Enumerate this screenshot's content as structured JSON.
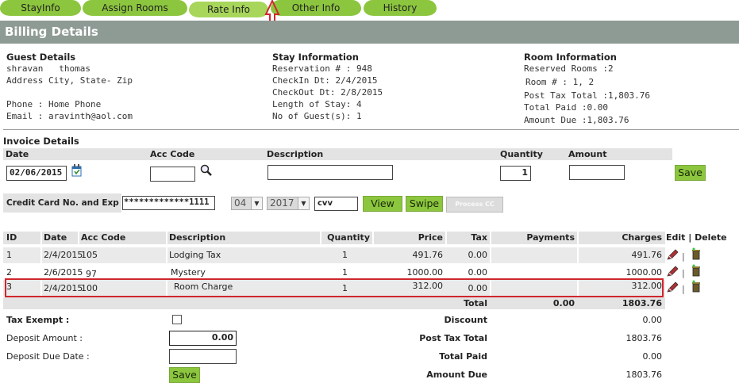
{
  "tabs": [
    {
      "label": "StayInfo"
    },
    {
      "label": "Assign Rooms"
    },
    {
      "label": "Rate Info"
    },
    {
      "label": "Other Info"
    },
    {
      "label": "History"
    }
  ],
  "billing_title": "Billing Details",
  "guest": {
    "title": "Guest Details",
    "name": "shravan   thomas",
    "address": "Address City, State- Zip",
    "phone": "Phone : Home Phone",
    "email": "Email : aravinth@aol.com"
  },
  "stay": {
    "title": "Stay Information",
    "reservation": "Reservation # : 948",
    "checkin": "CheckIn Dt: 2/4/2015",
    "checkout": "CheckOut Dt: 2/8/2015",
    "length": "Length of Stay: 4",
    "guests": "No of Guest(s): 1"
  },
  "room": {
    "title": "Room Information",
    "reserved": "Reserved Rooms :2",
    "room_no": "Room # : 1, 2",
    "post_tax_total": "Post Tax Total :1,803.76",
    "total_paid": "Total Paid :0.00",
    "amount_due": "Amount Due :1,803.76"
  },
  "invoice": {
    "title": "Invoice Details",
    "headers": {
      "date": "Date",
      "acc_code": "Acc Code",
      "description": "Description",
      "quantity": "Quantity",
      "amount": "Amount"
    },
    "date_value": "02/06/2015",
    "acc_code_value": "",
    "description_value": "",
    "quantity_value": "1",
    "amount_value": "",
    "save_label": "Save"
  },
  "credit_card": {
    "label": "Credit Card No. and Exp Dt",
    "number": "*************1111",
    "month": "04",
    "year": "2017",
    "cvv": "cvv",
    "view_label": "View",
    "swipe_label": "Swipe",
    "process_label": "Process CC"
  },
  "table": {
    "headers": {
      "id": "ID",
      "date": "Date",
      "acc_code": "Acc Code",
      "description": "Description",
      "quantity": "Quantity",
      "price": "Price",
      "tax": "Tax",
      "payments": "Payments",
      "charges": "Charges",
      "edit_delete": "Edit | Delete"
    },
    "rows": [
      {
        "id": "1",
        "date": "2/4/2015",
        "acc_code": "105",
        "description": "Lodging Tax",
        "quantity": "1",
        "price": "491.76",
        "tax": "0.00",
        "payments": "",
        "charges": "491.76"
      },
      {
        "id": "2",
        "date": "2/6/2015",
        "acc_code": "97",
        "description": "Mystery",
        "quantity": "1",
        "price": "1000.00",
        "tax": "0.00",
        "payments": "",
        "charges": "1000.00"
      },
      {
        "id": "3",
        "date": "2/4/2015",
        "acc_code": "100",
        "description": "Room Charge",
        "quantity": "1",
        "price": "312.00",
        "tax": "0.00",
        "payments": "",
        "charges": "312.00"
      }
    ],
    "total_label": "Total",
    "total_payments": "0.00",
    "total_charges": "1803.76",
    "edit_sep": "|"
  },
  "summary": {
    "tax_exempt_label": "Tax Exempt :",
    "deposit_amount_label": "Deposit Amount :",
    "deposit_amount_value": "0.00",
    "deposit_due_label": "Deposit Due Date :",
    "deposit_due_value": "",
    "save_label": "Save",
    "discount_label": "Discount",
    "discount_value": "0.00",
    "post_tax_label": "Post Tax Total",
    "post_tax_value": "1803.76",
    "total_paid_label": "Total Paid",
    "total_paid_value": "0.00",
    "amount_due_label": "Amount Due",
    "amount_due_value": "1803.76"
  },
  "colors": {
    "tab_green": "#8cc63e",
    "bar_gray": "#8e9b94",
    "highlight_red": "#d0262d"
  }
}
